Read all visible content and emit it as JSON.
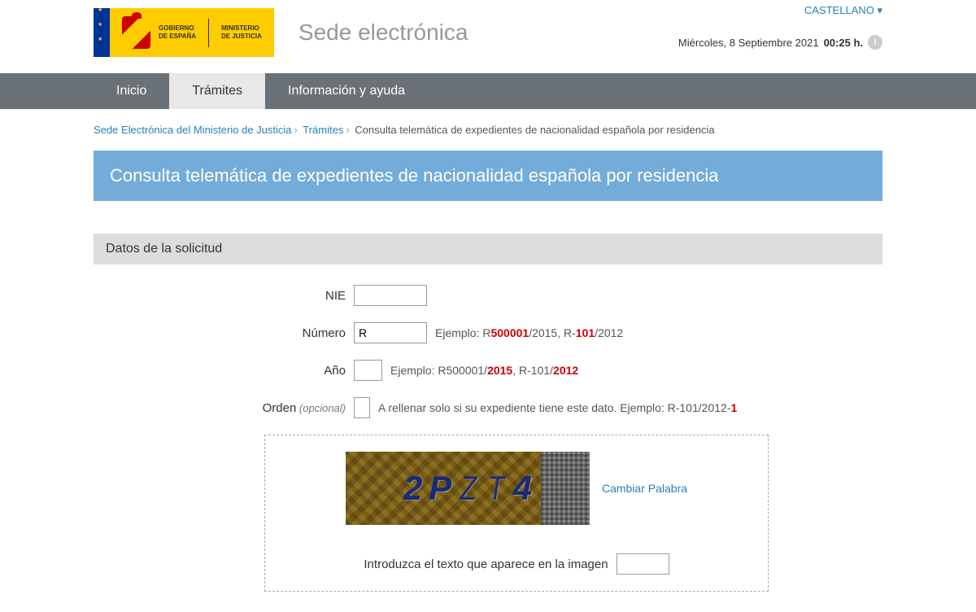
{
  "header": {
    "gov_label_1": "GOBIERNO",
    "gov_label_2": "DE ESPAÑA",
    "ministry_label_1": "MINISTERIO",
    "ministry_label_2": "DE JUSTICIA",
    "site_title": "Sede electrónica",
    "language": "CASTELLANO ▾",
    "date": "Miércoles, 8 Septiembre 2021",
    "time": "00:25 h."
  },
  "nav": {
    "inicio": "Inicio",
    "tramites": "Trámites",
    "info": "Información y ayuda"
  },
  "breadcrumb": {
    "home": "Sede Electrónica del Ministerio de Justicia",
    "section": "Trámites",
    "current": "Consulta telemática de expedientes de nacionalidad española por residencia"
  },
  "page_title": "Consulta telemática de expedientes de nacionalidad española por residencia",
  "section_title": "Datos de la solicitud",
  "form": {
    "nie_label": "NIE",
    "nie_value": "",
    "numero_label": "Número",
    "numero_value": "R",
    "numero_hint_prefix": "Ejemplo: R",
    "numero_hint_red1": "500001",
    "numero_hint_mid": "/2015, R-",
    "numero_hint_red2": "101",
    "numero_hint_suffix": "/2012",
    "ano_label": "Año",
    "ano_value": "",
    "ano_hint_prefix": "Ejemplo: R500001/",
    "ano_hint_red1": "2015",
    "ano_hint_mid": ", R-101/",
    "ano_hint_red2": "2012",
    "orden_label": "Orden",
    "orden_optional": " (opcional)",
    "orden_value": "",
    "orden_hint_prefix": "A rellenar solo si su expediente tiene este dato. Ejemplo: R-101/2012-",
    "orden_hint_red": "1"
  },
  "captcha": {
    "text": "2PZT4",
    "change_label": "Cambiar Palabra",
    "prompt": "Introduzca el texto que aparece en la imagen",
    "value": ""
  }
}
